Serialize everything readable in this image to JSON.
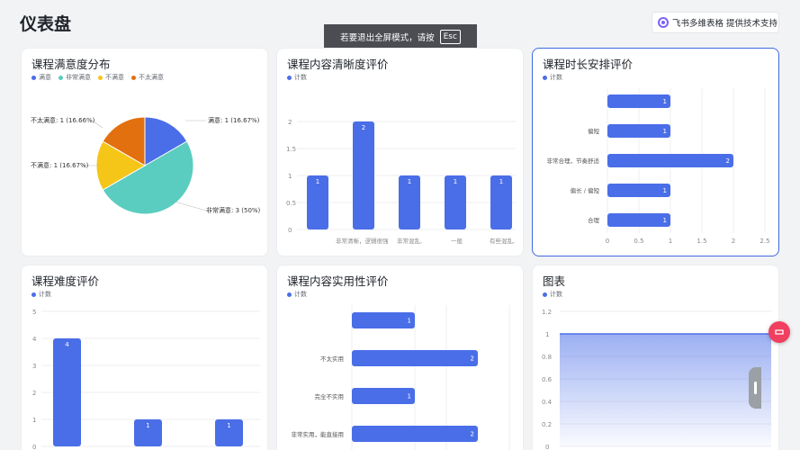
{
  "page": {
    "title": "仪表盘"
  },
  "support": {
    "label": "飞书多维表格 提供技术支持"
  },
  "esc_banner": {
    "text": "若要退出全屏模式，请按",
    "key": "Esc"
  },
  "colors": {
    "accent": "#4a6ee8",
    "teal": "#5acdc0",
    "yellow": "#f5c518",
    "orange": "#e3700e"
  },
  "cards": {
    "satisfaction": {
      "title": "课程满意度分布",
      "legend": [
        "满意",
        "非常满意",
        "不满意",
        "不太满意"
      ],
      "labels": {
        "manyi": "满意: 1 (16.67%)",
        "feichang": "非常满意: 3 (50%)",
        "bumanyi": "不满意: 1 (16.67%)",
        "butai": "不太满意: 1 (16.66%)"
      }
    },
    "clarity": {
      "title": "课程内容清晰度评价",
      "legend": "计数",
      "y_ticks": [
        "2",
        "1.5",
        "1",
        "0.5",
        "0"
      ],
      "categories": [
        "非常清晰，逻辑很强",
        "非常混乱,",
        "一般",
        "有些混乱,"
      ]
    },
    "duration": {
      "title": "课程时长安排评价",
      "legend": "计数",
      "categories": [
        "偏短",
        "非常合理，节奏舒适",
        "偏长 / 偏短",
        "合理"
      ],
      "x_ticks": [
        "0",
        "0.5",
        "1",
        "1.5",
        "2",
        "2.5"
      ]
    },
    "difficulty": {
      "title": "课程难度评价",
      "legend": "计数",
      "y_ticks": [
        "5",
        "4",
        "3",
        "2",
        "1",
        "0"
      ]
    },
    "practicality": {
      "title": "课程内容实用性评价",
      "legend": "计数",
      "categories": [
        "不太实用",
        "完全不实用",
        "非常实用，能直接用"
      ]
    },
    "chart": {
      "title": "图表",
      "legend": "计数",
      "y_ticks": [
        "1.2",
        "1",
        "0.8",
        "0.6",
        "0.4",
        "0.2",
        "0"
      ]
    }
  },
  "chart_data": [
    {
      "type": "pie",
      "title": "课程满意度分布",
      "slices": [
        {
          "name": "满意",
          "value": 1,
          "percent": 16.67,
          "color": "#4a6ee8"
        },
        {
          "name": "非常满意",
          "value": 3,
          "percent": 50,
          "color": "#5acdc0"
        },
        {
          "name": "不满意",
          "value": 1,
          "percent": 16.67,
          "color": "#f5c518"
        },
        {
          "name": "不太满意",
          "value": 1,
          "percent": 16.66,
          "color": "#e3700e"
        }
      ]
    },
    {
      "type": "bar",
      "title": "课程内容清晰度评价",
      "series": [
        {
          "name": "计数",
          "values": [
            1,
            2,
            1,
            1,
            1
          ]
        }
      ],
      "ylim": [
        0,
        2
      ]
    },
    {
      "type": "bar",
      "orientation": "horizontal",
      "title": "课程时长安排评价",
      "series": [
        {
          "name": "计数",
          "values": [
            1,
            1,
            2,
            1,
            1
          ]
        }
      ],
      "xlim": [
        0,
        2.5
      ]
    },
    {
      "type": "bar",
      "title": "课程难度评价",
      "series": [
        {
          "name": "计数",
          "values": [
            4,
            1,
            1
          ]
        }
      ],
      "ylim": [
        0,
        5
      ]
    },
    {
      "type": "bar",
      "orientation": "horizontal",
      "title": "课程内容实用性评价",
      "series": [
        {
          "name": "计数",
          "values": [
            1,
            2,
            1,
            2
          ]
        }
      ]
    },
    {
      "type": "area",
      "title": "图表",
      "series": [
        {
          "name": "计数",
          "values": [
            1,
            1
          ]
        }
      ],
      "ylim": [
        0,
        1.2
      ]
    }
  ]
}
